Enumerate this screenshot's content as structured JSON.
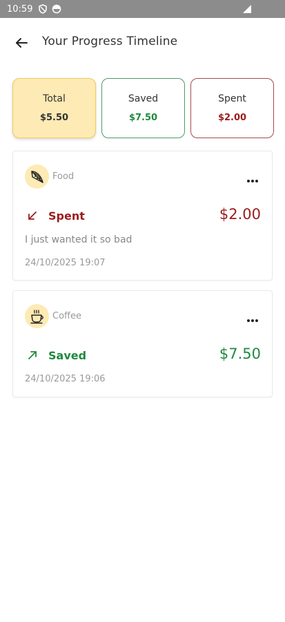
{
  "status_bar": {
    "time": "10:59",
    "icons": [
      "shield-icon",
      "circle-status-icon",
      "signal-icon"
    ]
  },
  "header": {
    "back_icon": "arrow-left-icon",
    "title": "Your Progress Timeline"
  },
  "summary": {
    "total": {
      "label": "Total",
      "value": "$5.50"
    },
    "saved": {
      "label": "Saved",
      "value": "$7.50"
    },
    "spent": {
      "label": "Spent",
      "value": "$2.00"
    }
  },
  "entries": [
    {
      "category": "Food",
      "category_icon": "pizza-slice-icon",
      "type": "Spent",
      "direction_icon": "arrow-down-left-icon",
      "amount": "$2.00",
      "note": "I just wanted it so bad",
      "timestamp": "24/10/2025 19:07"
    },
    {
      "category": "Coffee",
      "category_icon": "coffee-cup-icon",
      "type": "Saved",
      "direction_icon": "arrow-up-right-icon",
      "amount": "$7.50",
      "timestamp": "24/10/2025 19:06"
    }
  ],
  "colors": {
    "spent": "#9b1c1c",
    "saved": "#1e8a3e",
    "total_bg": "#fdeab4",
    "status_bar": "#8c8c8c"
  }
}
